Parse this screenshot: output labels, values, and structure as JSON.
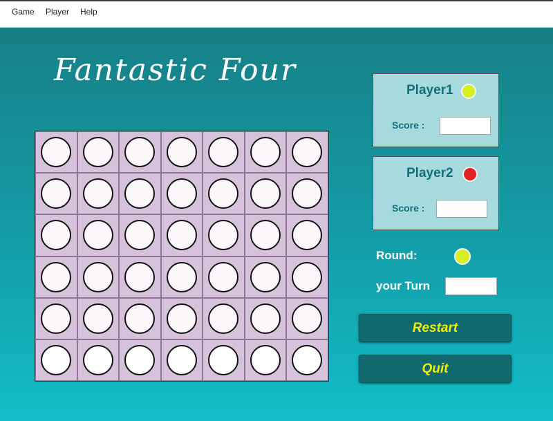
{
  "menu": {
    "items": [
      "Game",
      "Player",
      "Help"
    ]
  },
  "title": "Fantastic Four",
  "board": {
    "rows": 6,
    "cols": 7
  },
  "players": [
    {
      "name": "Player1",
      "score_label": "Score :",
      "score_value": "",
      "color": "#d6ee22"
    },
    {
      "name": "Player2",
      "score_label": "Score :",
      "score_value": "",
      "color": "#e52222"
    }
  ],
  "round": {
    "label": "Round:",
    "current_color": "#d6ee22"
  },
  "turn": {
    "label": "your Turn",
    "value": ""
  },
  "buttons": {
    "restart": "Restart",
    "quit": "Quit"
  },
  "colors": {
    "background_top": "#177f86",
    "background_bottom": "#12bec8",
    "board": "#d6c2db",
    "panel": "#a6dadd",
    "button": "#10696d",
    "button_text": "#f2f000"
  }
}
